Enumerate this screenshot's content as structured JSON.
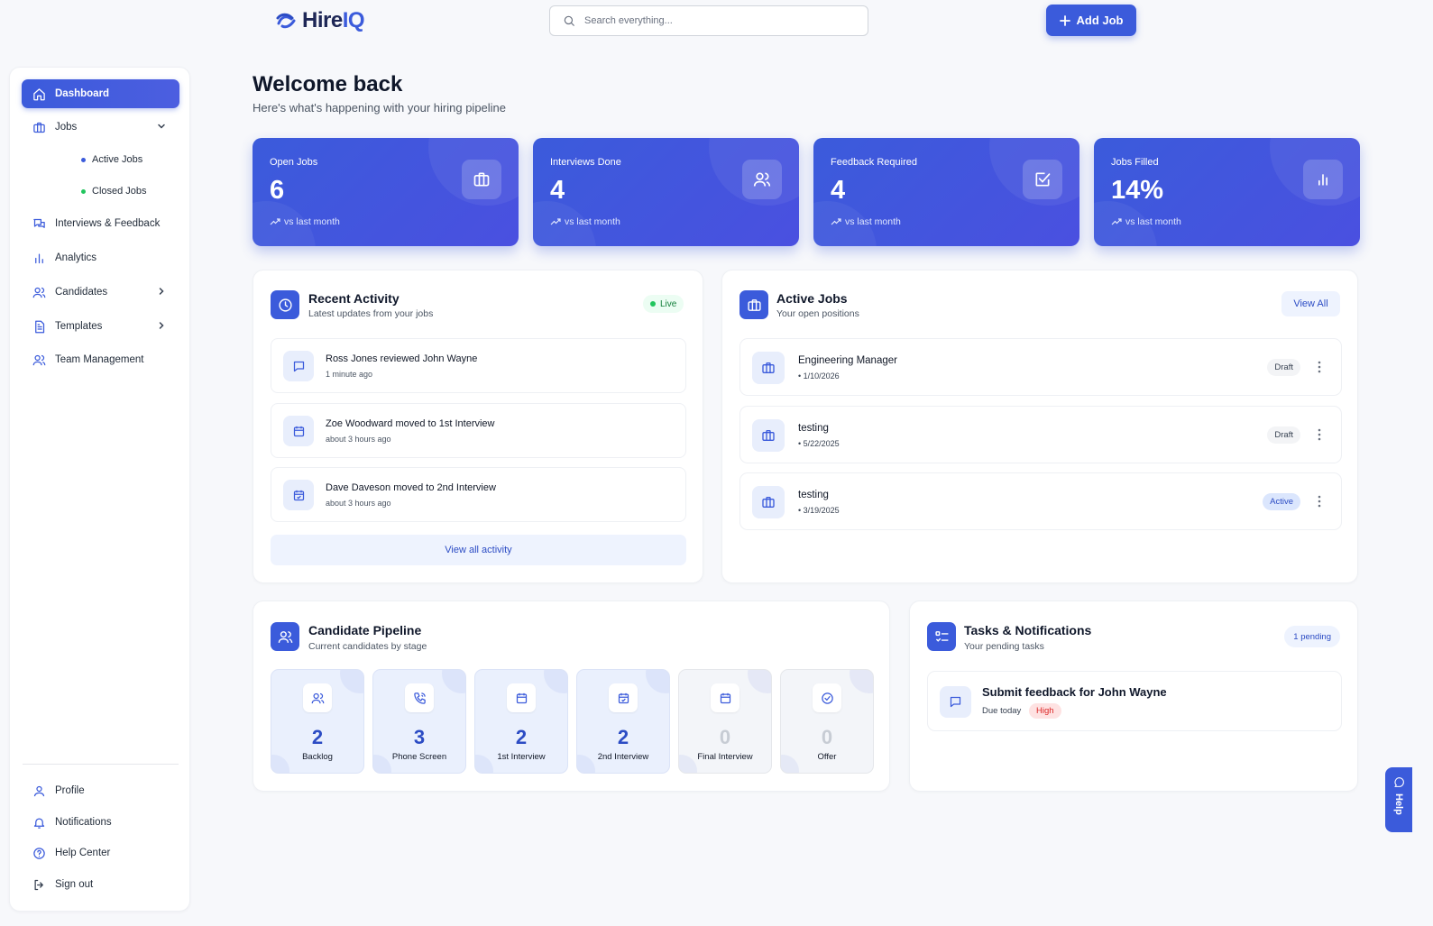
{
  "brand": {
    "name_a": "Hire",
    "name_b": "IQ"
  },
  "search": {
    "placeholder": "Search everything..."
  },
  "header": {
    "add_job_label": "Add Job"
  },
  "sidebar": {
    "items": [
      {
        "label": "Dashboard"
      },
      {
        "label": "Jobs"
      },
      {
        "label": "Interviews & Feedback"
      },
      {
        "label": "Analytics"
      },
      {
        "label": "Candidates"
      },
      {
        "label": "Templates"
      },
      {
        "label": "Team Management"
      }
    ],
    "job_subitems": [
      {
        "label": "Active Jobs",
        "color": "#3b5bdb"
      },
      {
        "label": "Closed Jobs",
        "color": "#22c55e"
      }
    ],
    "bottom": [
      {
        "label": "Profile"
      },
      {
        "label": "Notifications"
      },
      {
        "label": "Help Center"
      },
      {
        "label": "Sign out"
      }
    ]
  },
  "page": {
    "title": "Welcome back",
    "subtitle": "Here's what's happening with your hiring pipeline"
  },
  "stats": [
    {
      "label": "Open Jobs",
      "value": "6",
      "trend": "vs last month",
      "icon": "briefcase-icon"
    },
    {
      "label": "Interviews Done",
      "value": "4",
      "trend": "vs last month",
      "icon": "users-icon"
    },
    {
      "label": "Feedback Required",
      "value": "4",
      "trend": "vs last month",
      "icon": "check-square-icon"
    },
    {
      "label": "Jobs Filled",
      "value": "14%",
      "trend": "vs last month",
      "icon": "bar-chart-icon"
    }
  ],
  "activity": {
    "title": "Recent Activity",
    "subtitle": "Latest updates from your jobs",
    "live_label": "Live",
    "items": [
      {
        "text": "Ross Jones reviewed John Wayne",
        "time": "1 minute ago",
        "icon": "message-icon"
      },
      {
        "text": "Zoe Woodward moved to 1st Interview",
        "time": "about 3 hours ago",
        "icon": "calendar-icon"
      },
      {
        "text": "Dave Daveson moved to 2nd Interview",
        "time": "about 3 hours ago",
        "icon": "calendar-check-icon"
      }
    ],
    "view_all_label": "View all activity"
  },
  "active_jobs": {
    "title": "Active Jobs",
    "subtitle": "Your open positions",
    "view_all_label": "View All",
    "items": [
      {
        "title": "Engineering Manager",
        "date": "• 1/10/2026",
        "status": "Draft"
      },
      {
        "title": "testing",
        "date": "• 5/22/2025",
        "status": "Draft"
      },
      {
        "title": "testing",
        "date": "• 3/19/2025",
        "status": "Active"
      }
    ]
  },
  "pipeline": {
    "title": "Candidate Pipeline",
    "subtitle": "Current candidates by stage",
    "stages": [
      {
        "label": "Backlog",
        "count": "2",
        "icon": "users-icon"
      },
      {
        "label": "Phone Screen",
        "count": "3",
        "icon": "phone-icon"
      },
      {
        "label": "1st Interview",
        "count": "2",
        "icon": "calendar-icon"
      },
      {
        "label": "2nd Interview",
        "count": "2",
        "icon": "calendar-check-icon"
      },
      {
        "label": "Final Interview",
        "count": "0",
        "icon": "calendar-icon"
      },
      {
        "label": "Offer",
        "count": "0",
        "icon": "check-circle-icon"
      }
    ]
  },
  "tasks": {
    "title": "Tasks & Notifications",
    "subtitle": "Your pending tasks",
    "pending_label": "1 pending",
    "items": [
      {
        "title": "Submit feedback for John Wayne",
        "due": "Due today",
        "priority": "High"
      }
    ]
  },
  "help_tab": {
    "label": "Help"
  },
  "colors": {
    "accent": "#3b5bdb",
    "live": "#22c55e",
    "high": "#dc2626"
  }
}
